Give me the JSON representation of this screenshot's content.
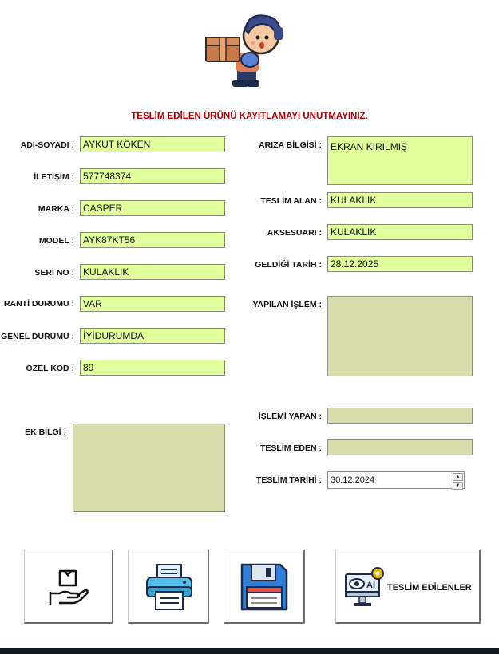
{
  "header": {
    "title": "TESLİM EDİLEN ÜRÜNÜ KAYITLAMAYI UNUTMAYINIZ."
  },
  "left": {
    "adi_soyadi": {
      "label": "ADI-SOYADI :",
      "value": "AYKUT KÖKEN"
    },
    "iletisim": {
      "label": "İLETİŞİM :",
      "value": "577748374"
    },
    "marka": {
      "label": "MARKA :",
      "value": "CASPER"
    },
    "model": {
      "label": "MODEL :",
      "value": "AYK87KT56"
    },
    "seri_no": {
      "label": "SERİ NO :",
      "value": "KULAKLIK"
    },
    "garanti": {
      "label": "RANTİ DURUMU :",
      "value": "VAR"
    },
    "genel": {
      "label": "GENEL DURUMU :",
      "value": "İYİDURUMDA"
    },
    "ozel_kod": {
      "label": "ÖZEL KOD :",
      "value": "89"
    },
    "ek_bilgi": {
      "label": "EK BİLGİ :",
      "value": ""
    }
  },
  "right": {
    "ariza": {
      "label": "ARIZA BİLGİSİ :",
      "value": "EKRAN KIRILMIŞ"
    },
    "teslim_alan": {
      "label": "TESLİM ALAN :",
      "value": "KULAKLIK"
    },
    "aksesuari": {
      "label": "AKSESUARI :",
      "value": "KULAKLIK"
    },
    "geldigi": {
      "label": "GELDİĞİ TARİH :",
      "value": "28.12.2025"
    },
    "yapilan": {
      "label": "YAPILAN İŞLEM :",
      "value": ""
    },
    "islemi_yapan": {
      "label": "İŞLEMİ YAPAN :",
      "value": ""
    },
    "teslim_eden": {
      "label": "TESLİM EDEN :",
      "value": ""
    },
    "teslim_tarihi": {
      "label": "TESLİM TARİHİ :",
      "value": "30.12.2024"
    }
  },
  "buttons": {
    "teslim_edilenler": "TESLİM EDİLENLER"
  },
  "icons": {
    "logo": "delivery-man-with-box-icon",
    "deliver": "hand-with-package-icon",
    "print": "printer-icon",
    "save": "floppy-disk-icon",
    "ai": "ai-monitor-icon"
  },
  "colors": {
    "field": "#e1ff9a",
    "big_field": "#daddab",
    "title": "#b40000"
  }
}
